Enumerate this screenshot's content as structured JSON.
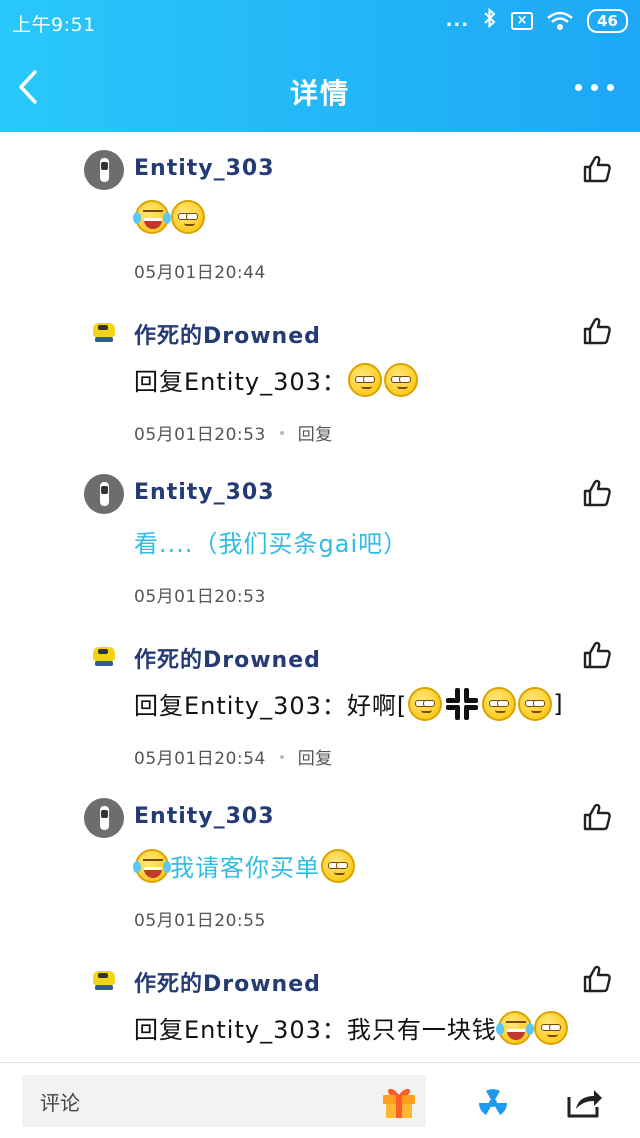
{
  "status_bar": {
    "time": "上午9:51",
    "signal_dots": "...",
    "battery": "46"
  },
  "header": {
    "title": "详情"
  },
  "comments": [
    {
      "username": "Entity_303",
      "avatar": "gray",
      "parts": [
        {
          "e": "laugh"
        },
        {
          "e": "smirk"
        }
      ],
      "timestamp": "05月01日20:44",
      "reply": ""
    },
    {
      "username": "作死的Drowned",
      "avatar": "yellow",
      "parts": [
        {
          "t": "回复Entity_303："
        },
        {
          "e": "smirk"
        },
        {
          "e": "smirk"
        }
      ],
      "timestamp": "05月01日20:53",
      "reply": "回复"
    },
    {
      "username": "Entity_303",
      "avatar": "gray",
      "cyan": true,
      "parts": [
        {
          "t": "看....（我们买条gai吧）"
        }
      ],
      "timestamp": "05月01日20:53",
      "reply": ""
    },
    {
      "username": "作死的Drowned",
      "avatar": "yellow",
      "parts": [
        {
          "t": "回复Entity_303：好啊["
        },
        {
          "e": "smirk"
        },
        {
          "e": "anger"
        },
        {
          "e": "smirk"
        },
        {
          "e": "smirk"
        },
        {
          "t": "]"
        }
      ],
      "timestamp": "05月01日20:54",
      "reply": "回复"
    },
    {
      "username": "Entity_303",
      "avatar": "gray",
      "cyan": true,
      "parts": [
        {
          "e": "laugh"
        },
        {
          "t": "我请客你买单"
        },
        {
          "e": "smirk"
        }
      ],
      "timestamp": "05月01日20:55",
      "reply": ""
    },
    {
      "username": "作死的Drowned",
      "avatar": "yellow",
      "parts": [
        {
          "t": "回复Entity_303：我只有一块钱"
        },
        {
          "e": "laugh"
        },
        {
          "e": "smirk"
        }
      ],
      "timestamp": "",
      "reply": ""
    }
  ],
  "bottom_bar": {
    "comment_placeholder": "评论"
  },
  "icons": {
    "back": "back-arrow-icon",
    "more": "more-dots-icon",
    "like": "thumbs-up-icon",
    "gift": "gift-icon",
    "radiation": "radiation-icon",
    "share": "share-icon",
    "emoji_laugh": "laugh-tears-emoji-icon",
    "emoji_smirk": "smirk-emoji-icon",
    "emoji_anger": "anger-symbol-icon"
  },
  "colors": {
    "header_start": "#29c8fa",
    "header_end": "#1ea7f6",
    "username": "#243b74",
    "cyan_text": "#2fbde4",
    "radiation": "#1e9af0"
  }
}
